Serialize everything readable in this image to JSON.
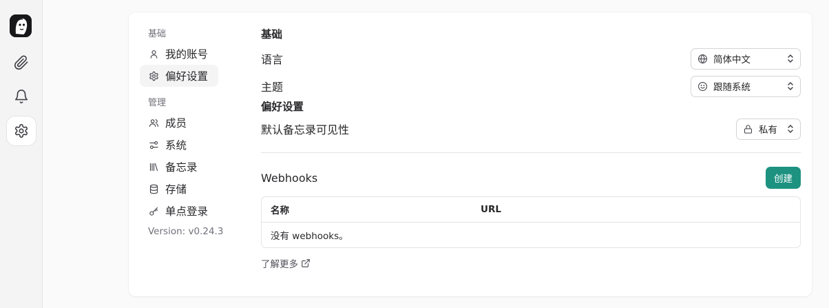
{
  "rail": {
    "items": [
      {
        "icon": "paperclip-icon"
      },
      {
        "icon": "bell-icon"
      },
      {
        "icon": "gear-icon",
        "active": true
      }
    ]
  },
  "nav": {
    "basic_title": "基础",
    "basic_items": [
      {
        "label": "我的账号",
        "icon": "user-icon"
      },
      {
        "label": "偏好设置",
        "icon": "gear-icon",
        "active": true
      }
    ],
    "admin_title": "管理",
    "admin_items": [
      {
        "label": "成员",
        "icon": "users-icon"
      },
      {
        "label": "系统",
        "icon": "sliders-icon"
      },
      {
        "label": "备忘录",
        "icon": "library-icon"
      },
      {
        "label": "存储",
        "icon": "database-icon"
      },
      {
        "label": "单点登录",
        "icon": "key-icon"
      }
    ],
    "version": "Version: v0.24.3"
  },
  "main": {
    "basic_heading": "基础",
    "language_label": "语言",
    "language_value": "简体中文",
    "theme_label": "主题",
    "theme_value": "跟随系统",
    "pref_heading": "偏好设置",
    "visibility_label": "默认备忘录可见性",
    "visibility_value": "私有",
    "webhooks_title": "Webhooks",
    "create_label": "创建",
    "table": {
      "col_name": "名称",
      "col_url": "URL",
      "empty": "没有 webhooks。"
    },
    "learn_more": "了解更多"
  },
  "colors": {
    "accent": "#1d9281",
    "background": "#fafafa",
    "border": "#e4e4e7"
  }
}
